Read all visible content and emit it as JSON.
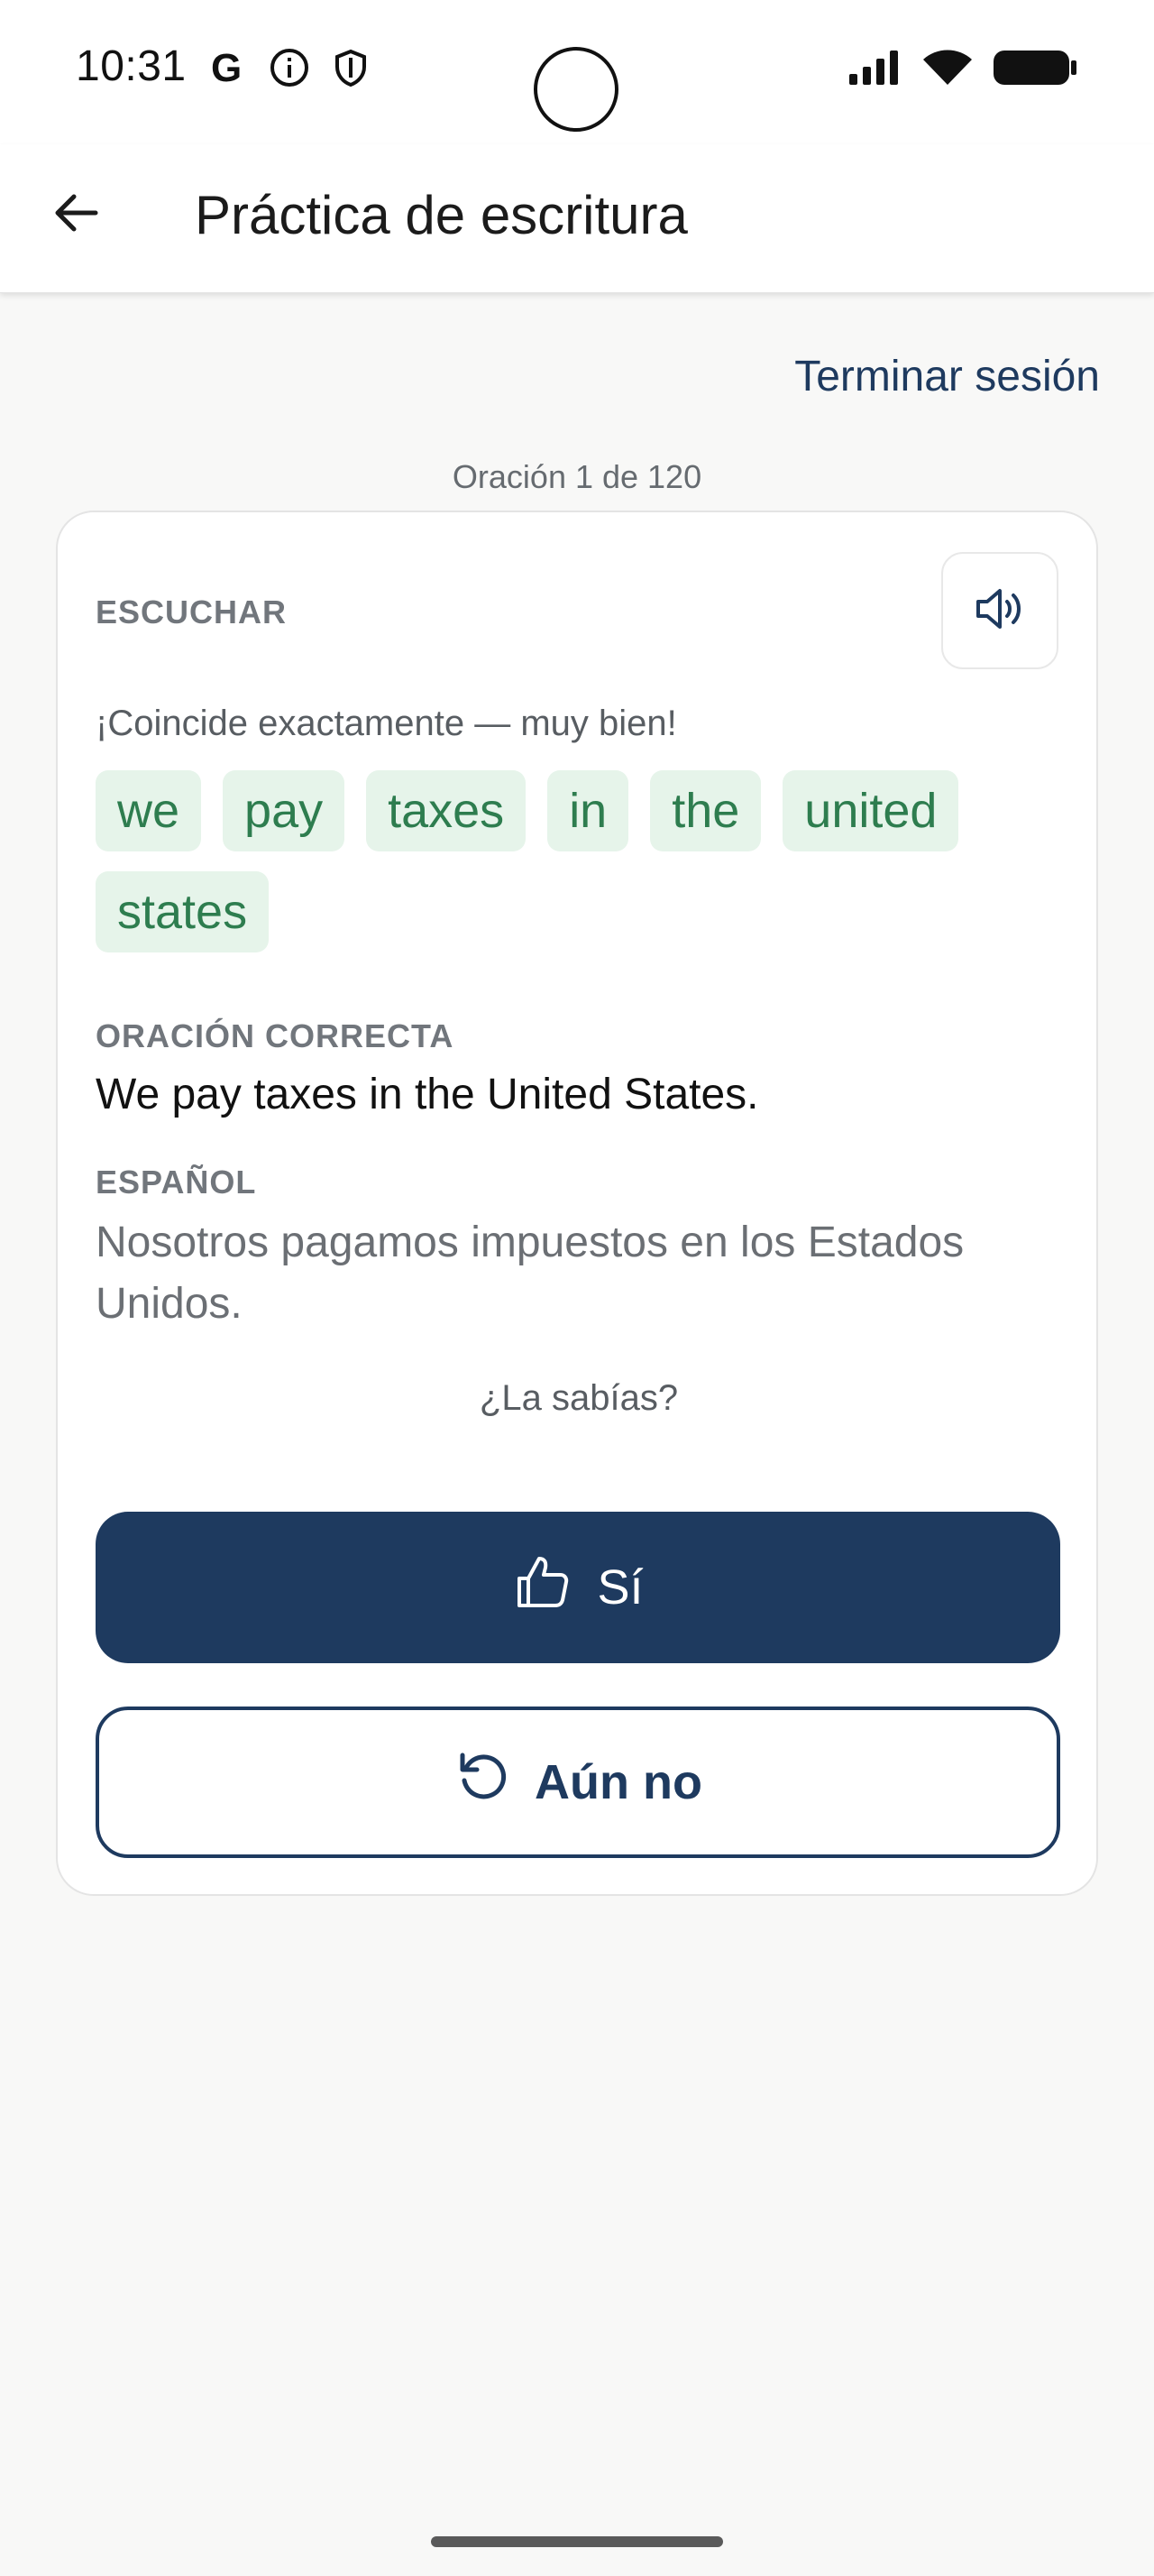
{
  "status_bar": {
    "time": "10:31",
    "left_icons": [
      "google-icon",
      "info-icon",
      "shield-icon"
    ],
    "right_icons": [
      "signal-icon",
      "wifi-icon",
      "battery-icon"
    ]
  },
  "app_bar": {
    "title": "Práctica de escritura",
    "back_icon": "arrow-left-icon"
  },
  "session": {
    "end_label": "Terminar sesión",
    "progress": "Oración 1 de 120"
  },
  "card": {
    "listen_label": "ESCUCHAR",
    "speaker_icon": "speaker-icon",
    "feedback": "¡Coincide exactamente — muy bien!",
    "tokens": [
      "we",
      "pay",
      "taxes",
      "in",
      "the",
      "united",
      "states"
    ],
    "correct_label": "ORACIÓN CORRECTA",
    "correct_sentence": "We pay taxes in the United States.",
    "spanish_label": "ESPAÑOL",
    "spanish_sentence": "Nosotros pagamos impuestos en los Estados Unidos.",
    "question": "¿La sabías?",
    "yes_label": "Sí",
    "not_yet_label": "Aún no"
  },
  "colors": {
    "primary": "#1e3a5f",
    "token_bg": "#e6f4ea",
    "token_text": "#2e7d4f",
    "background": "#f8f8f7"
  }
}
